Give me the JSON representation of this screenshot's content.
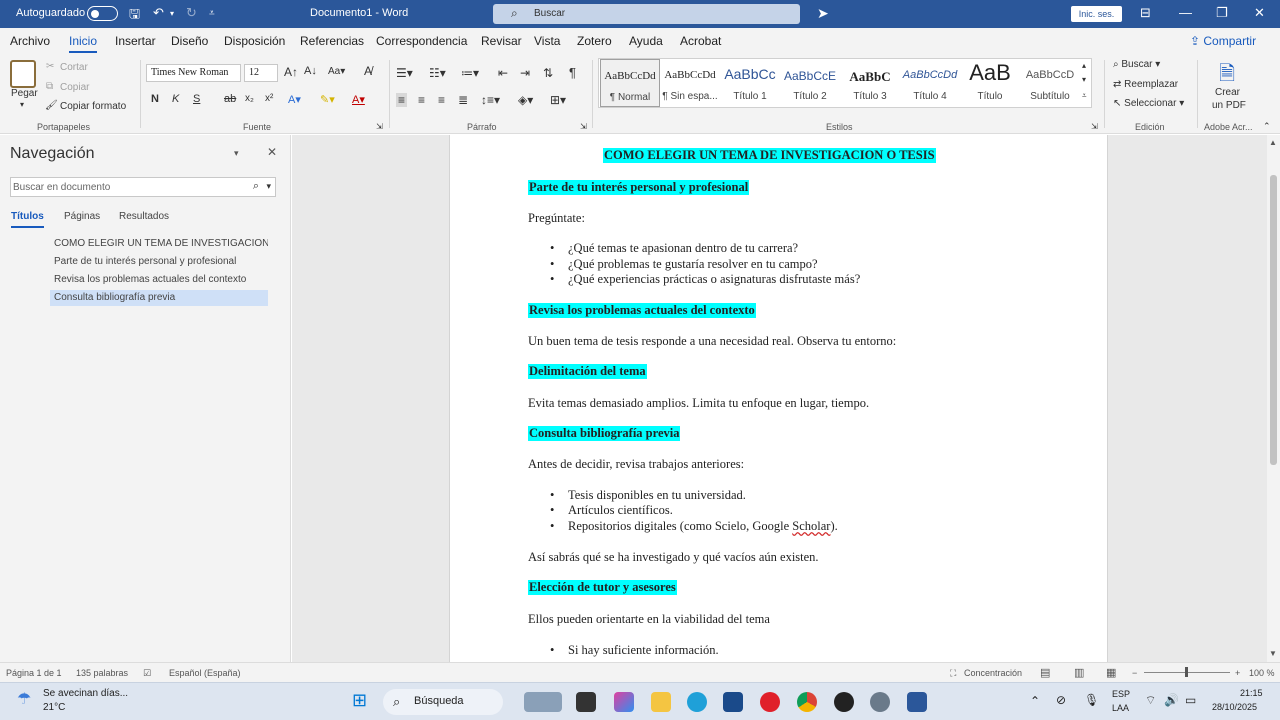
{
  "titlebar": {
    "autosave": "Autoguardado",
    "doc_title": "Documento1  -  Word",
    "search_placeholder": "Buscar",
    "signin": "Inic. ses."
  },
  "menu": {
    "items": [
      "Archivo",
      "Inicio",
      "Insertar",
      "Diseño",
      "Disposición",
      "Referencias",
      "Correspondencia",
      "Revisar",
      "Vista",
      "Zotero",
      "Ayuda",
      "Acrobat"
    ],
    "share": "Compartir"
  },
  "ribbon": {
    "clipboard": {
      "paste": "Pegar",
      "cut": "Cortar",
      "copy": "Copiar",
      "format_painter": "Copiar formato",
      "label": "Portapapeles"
    },
    "font": {
      "name": "Times New Roman",
      "size": "12",
      "bold": "N",
      "italic": "K",
      "underline": "S",
      "label": "Fuente"
    },
    "paragraph": {
      "label": "Párrafo"
    },
    "styles": {
      "label": "Estilos",
      "items": [
        {
          "sample": "AaBbCcDd",
          "name": "¶ Normal"
        },
        {
          "sample": "AaBbCcDd",
          "name": "¶ Sin espa..."
        },
        {
          "sample": "AaBbCc",
          "name": "Título 1"
        },
        {
          "sample": "AaBbCcE",
          "name": "Título 2"
        },
        {
          "sample": "AaBbC",
          "name": "Título 3"
        },
        {
          "sample": "AaBbCcDd",
          "name": "Título 4"
        },
        {
          "sample": "AaB",
          "name": "Título"
        },
        {
          "sample": "AaBbCcD",
          "name": "Subtítulo"
        }
      ]
    },
    "editing": {
      "find": "Buscar",
      "replace": "Reemplazar",
      "select": "Seleccionar",
      "label": "Edición"
    },
    "acrobat": {
      "create_pdf_1": "Crear",
      "create_pdf_2": "un PDF",
      "label": "Adobe Acr..."
    }
  },
  "nav": {
    "title": "Navegación",
    "search_placeholder": "Buscar en documento",
    "tabs": [
      "Títulos",
      "Páginas",
      "Resultados"
    ],
    "headings": [
      "COMO ELEGIR UN TEMA DE INVESTIGACION...",
      "Parte de tu interés personal y profesional",
      "Revisa los problemas actuales del contexto",
      "Consulta bibliografía previa"
    ]
  },
  "document": {
    "title": "COMO ELEGIR UN TEMA DE INVESTIGACION O TESIS",
    "h1": "Parte de tu interés personal y profesional",
    "p1": "Pregúntate:",
    "list1": [
      "¿Qué temas te apasionan dentro de tu carrera?",
      "¿Qué problemas te gustaría resolver en tu campo?",
      "¿Qué experiencias prácticas o asignaturas disfrutaste más?"
    ],
    "h2": "Revisa los problemas actuales del contexto",
    "p2": "Un buen tema de tesis responde a una necesidad real. Observa tu entorno:",
    "h3": "Delimitación del tema",
    "p3": "Evita temas demasiado amplios. Limita tu enfoque en lugar, tiempo.",
    "h4": "Consulta bibliografía previa",
    "p4": "Antes de decidir, revisa trabajos anteriores:",
    "list2": [
      "Tesis disponibles en tu universidad.",
      "Artículos científicos.",
      "Repositorios digitales (como Scielo, Google "
    ],
    "list2_scholar": "Scholar",
    "list2_end": ").",
    "p5": "Así sabrás qué se ha investigado y qué vacíos aún existen.",
    "h5": "Elección de tutor y asesores",
    "p6": "Ellos pueden orientarte en la viabilidad del tema",
    "list3": [
      "Si hay suficiente información."
    ]
  },
  "status": {
    "page": "Página 1 de 1",
    "words": "135 palabras",
    "language": "Español (España)",
    "focus": "Concentración",
    "zoom": "100 %"
  },
  "taskbar": {
    "weather_text": "Se avecinan días...",
    "weather_temp": "21°C",
    "search": "Búsqueda",
    "lang1": "ESP",
    "lang2": "LAA",
    "time": "21:15",
    "date": "28/10/2025"
  }
}
